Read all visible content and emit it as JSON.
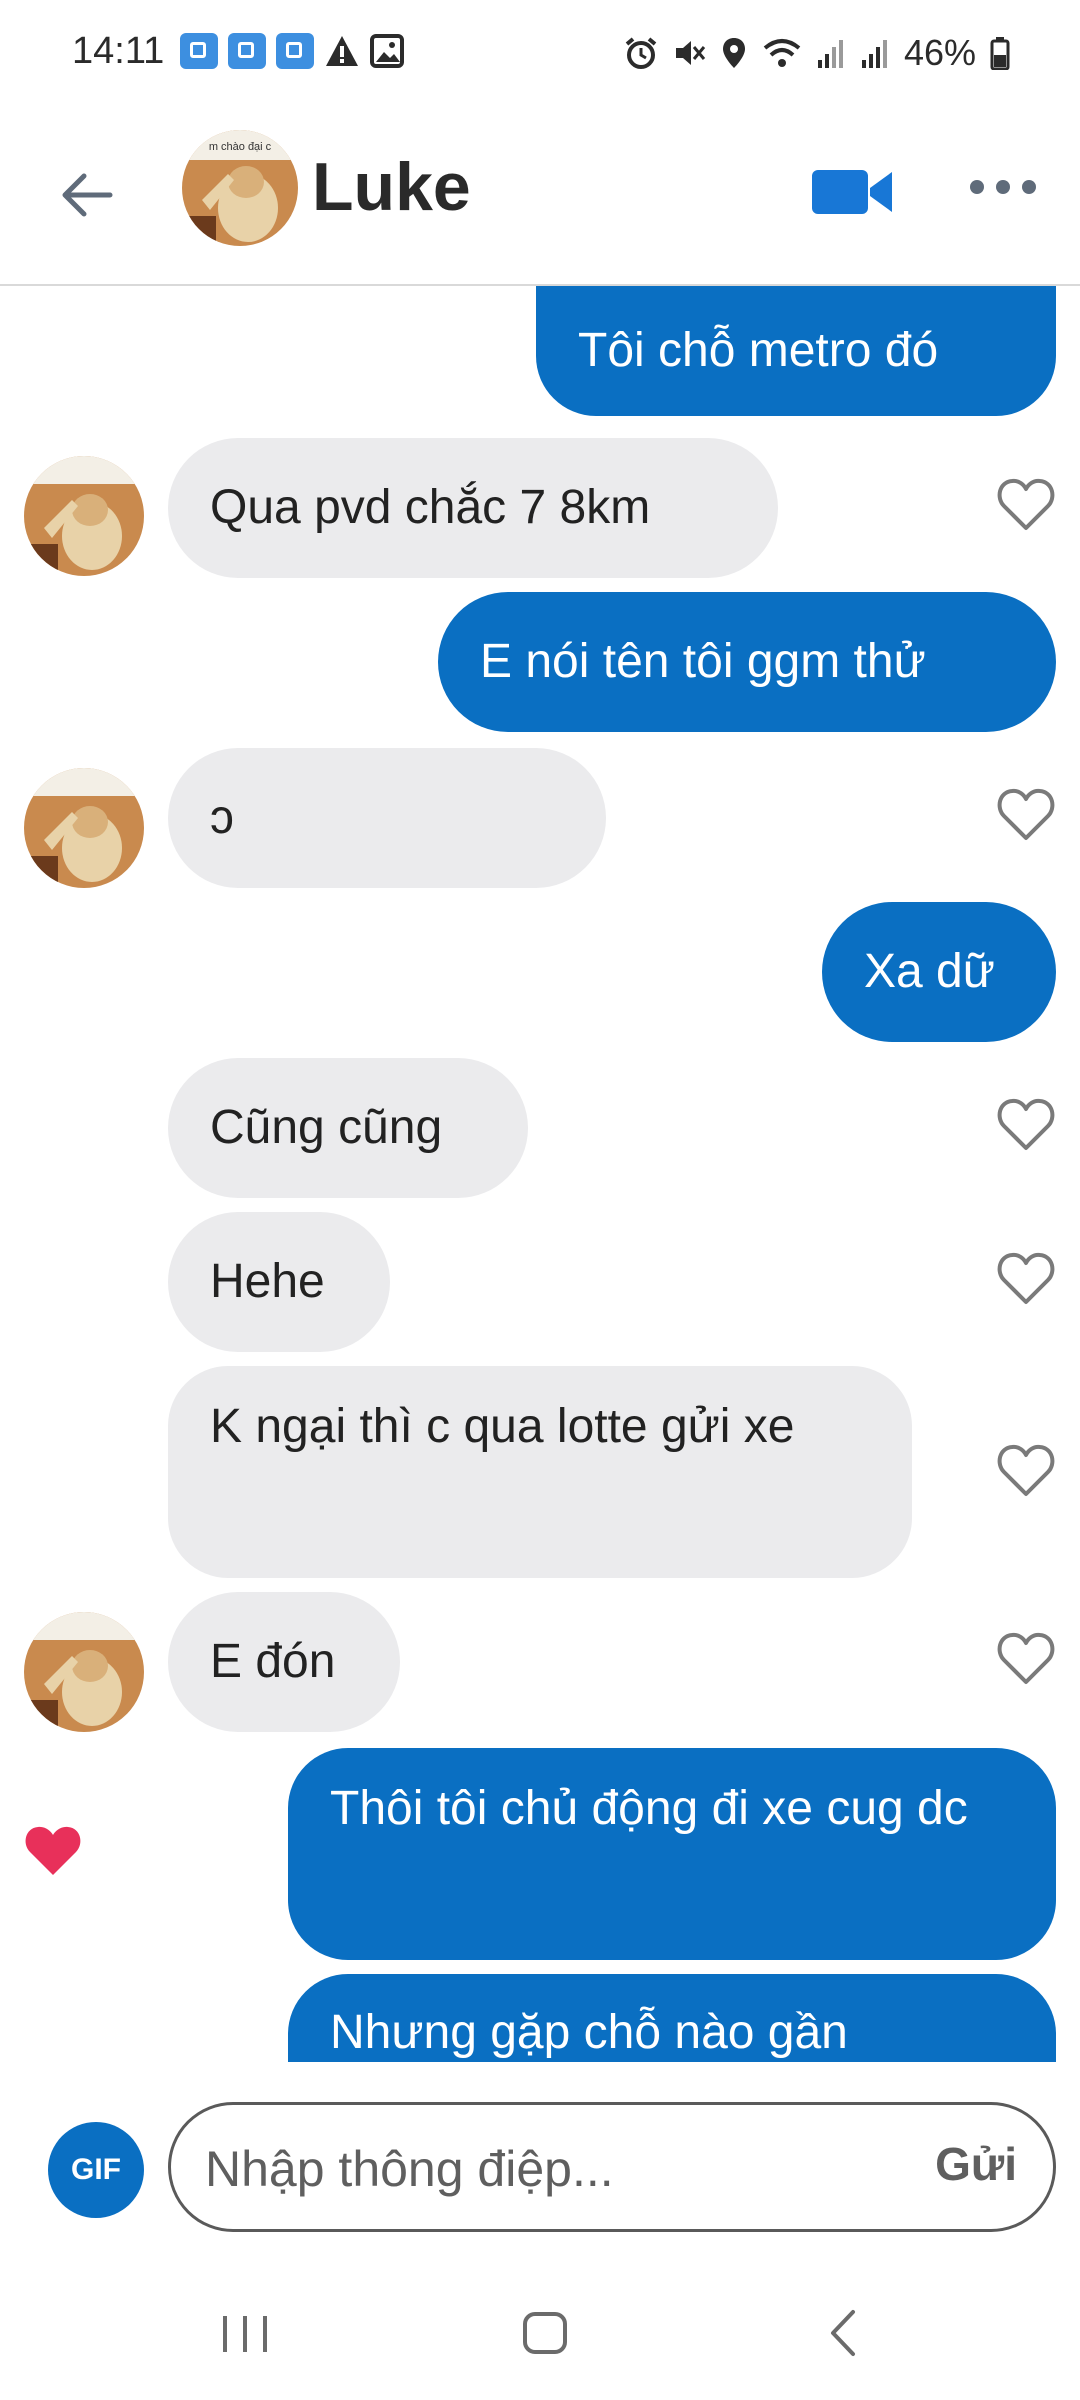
{
  "status_bar": {
    "time": "14:11",
    "battery": "46%",
    "notification_icons": [
      "app-notification-icon",
      "app-notification-icon",
      "app-notification-icon",
      "warning-icon",
      "image-icon"
    ],
    "system_icons": [
      "alarm-icon",
      "mute-icon",
      "location-icon",
      "wifi-icon",
      "signal-icon",
      "signal-icon",
      "battery-icon"
    ]
  },
  "header": {
    "contact_name": "Luke",
    "avatar_caption": "m chào đại c"
  },
  "messages": [
    {
      "direction": "out",
      "text": "Tôi chỗ metro đó"
    },
    {
      "direction": "in",
      "text": "Qua pvd chắc 7 8km",
      "show_avatar": true
    },
    {
      "direction": "out",
      "text": "E nói tên tôi ggm thử"
    },
    {
      "direction": "in",
      "text": "ↄ",
      "show_avatar": true
    },
    {
      "direction": "out",
      "text": "Xa dữ"
    },
    {
      "direction": "in",
      "text": "Cũng cũng"
    },
    {
      "direction": "in",
      "text": "Hehe"
    },
    {
      "direction": "in",
      "text": "K ngại thì c qua lotte gửi xe"
    },
    {
      "direction": "in",
      "text": "E đón",
      "show_avatar": true
    },
    {
      "direction": "out",
      "text": "Thôi tôi chủ động đi xe cug dc",
      "liked": true
    },
    {
      "direction": "out",
      "text": "Nhưng gặp chỗ nào gần"
    }
  ],
  "composer": {
    "gif_label": "GIF",
    "placeholder": "Nhập thông điệp...",
    "send_label": "Gửi"
  },
  "colors": {
    "outgoing_bubble": "#0a6fc2",
    "incoming_bubble": "#ebebed",
    "like_heart": "#e8305a"
  }
}
